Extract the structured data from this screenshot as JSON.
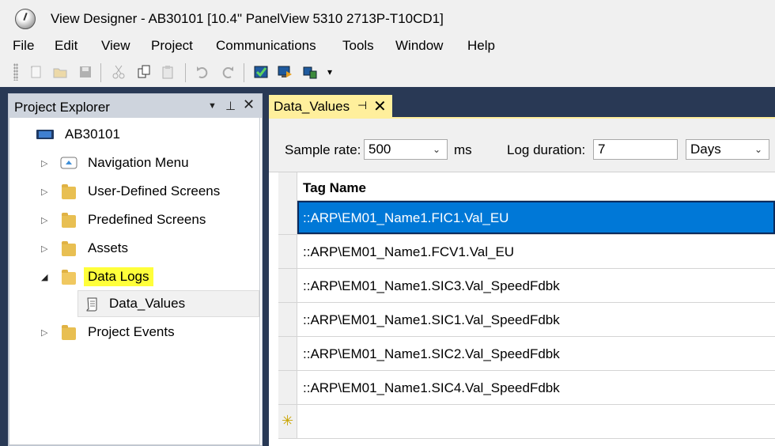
{
  "window": {
    "title": "View Designer - AB30101 [10.4\" PanelView 5310 2713P-T10CD1]"
  },
  "menu": [
    "File",
    "Edit",
    "View",
    "Project",
    "Communications",
    "Tools",
    "Window",
    "Help"
  ],
  "project_explorer": {
    "title": "Project Explorer",
    "root": "AB30101",
    "items": [
      {
        "label": "Navigation Menu"
      },
      {
        "label": "User-Defined Screens"
      },
      {
        "label": "Predefined Screens"
      },
      {
        "label": "Assets"
      },
      {
        "label": "Data Logs"
      },
      {
        "label": "Data_Values"
      },
      {
        "label": "Project Events"
      }
    ]
  },
  "doc_tab": {
    "label": "Data_Values"
  },
  "settings": {
    "sample_rate_label": "Sample rate:",
    "sample_rate_value": "500",
    "sample_rate_unit": "ms",
    "log_duration_label": "Log duration:",
    "log_duration_value": "7",
    "log_duration_unit": "Days"
  },
  "grid": {
    "header": "Tag Name",
    "rows": [
      "::ARP\\EM01_Name1.FIC1.Val_EU",
      "::ARP\\EM01_Name1.FCV1.Val_EU",
      "::ARP\\EM01_Name1.SIC3.Val_SpeedFdbk",
      "::ARP\\EM01_Name1.SIC1.Val_SpeedFdbk",
      "::ARP\\EM01_Name1.SIC2.Val_SpeedFdbk",
      "::ARP\\EM01_Name1.SIC4.Val_SpeedFdbk"
    ]
  },
  "colors": {
    "dock": "#293955",
    "tab_active": "#ffef9c",
    "selection": "#0078d7",
    "highlight": "#ffff3a"
  }
}
